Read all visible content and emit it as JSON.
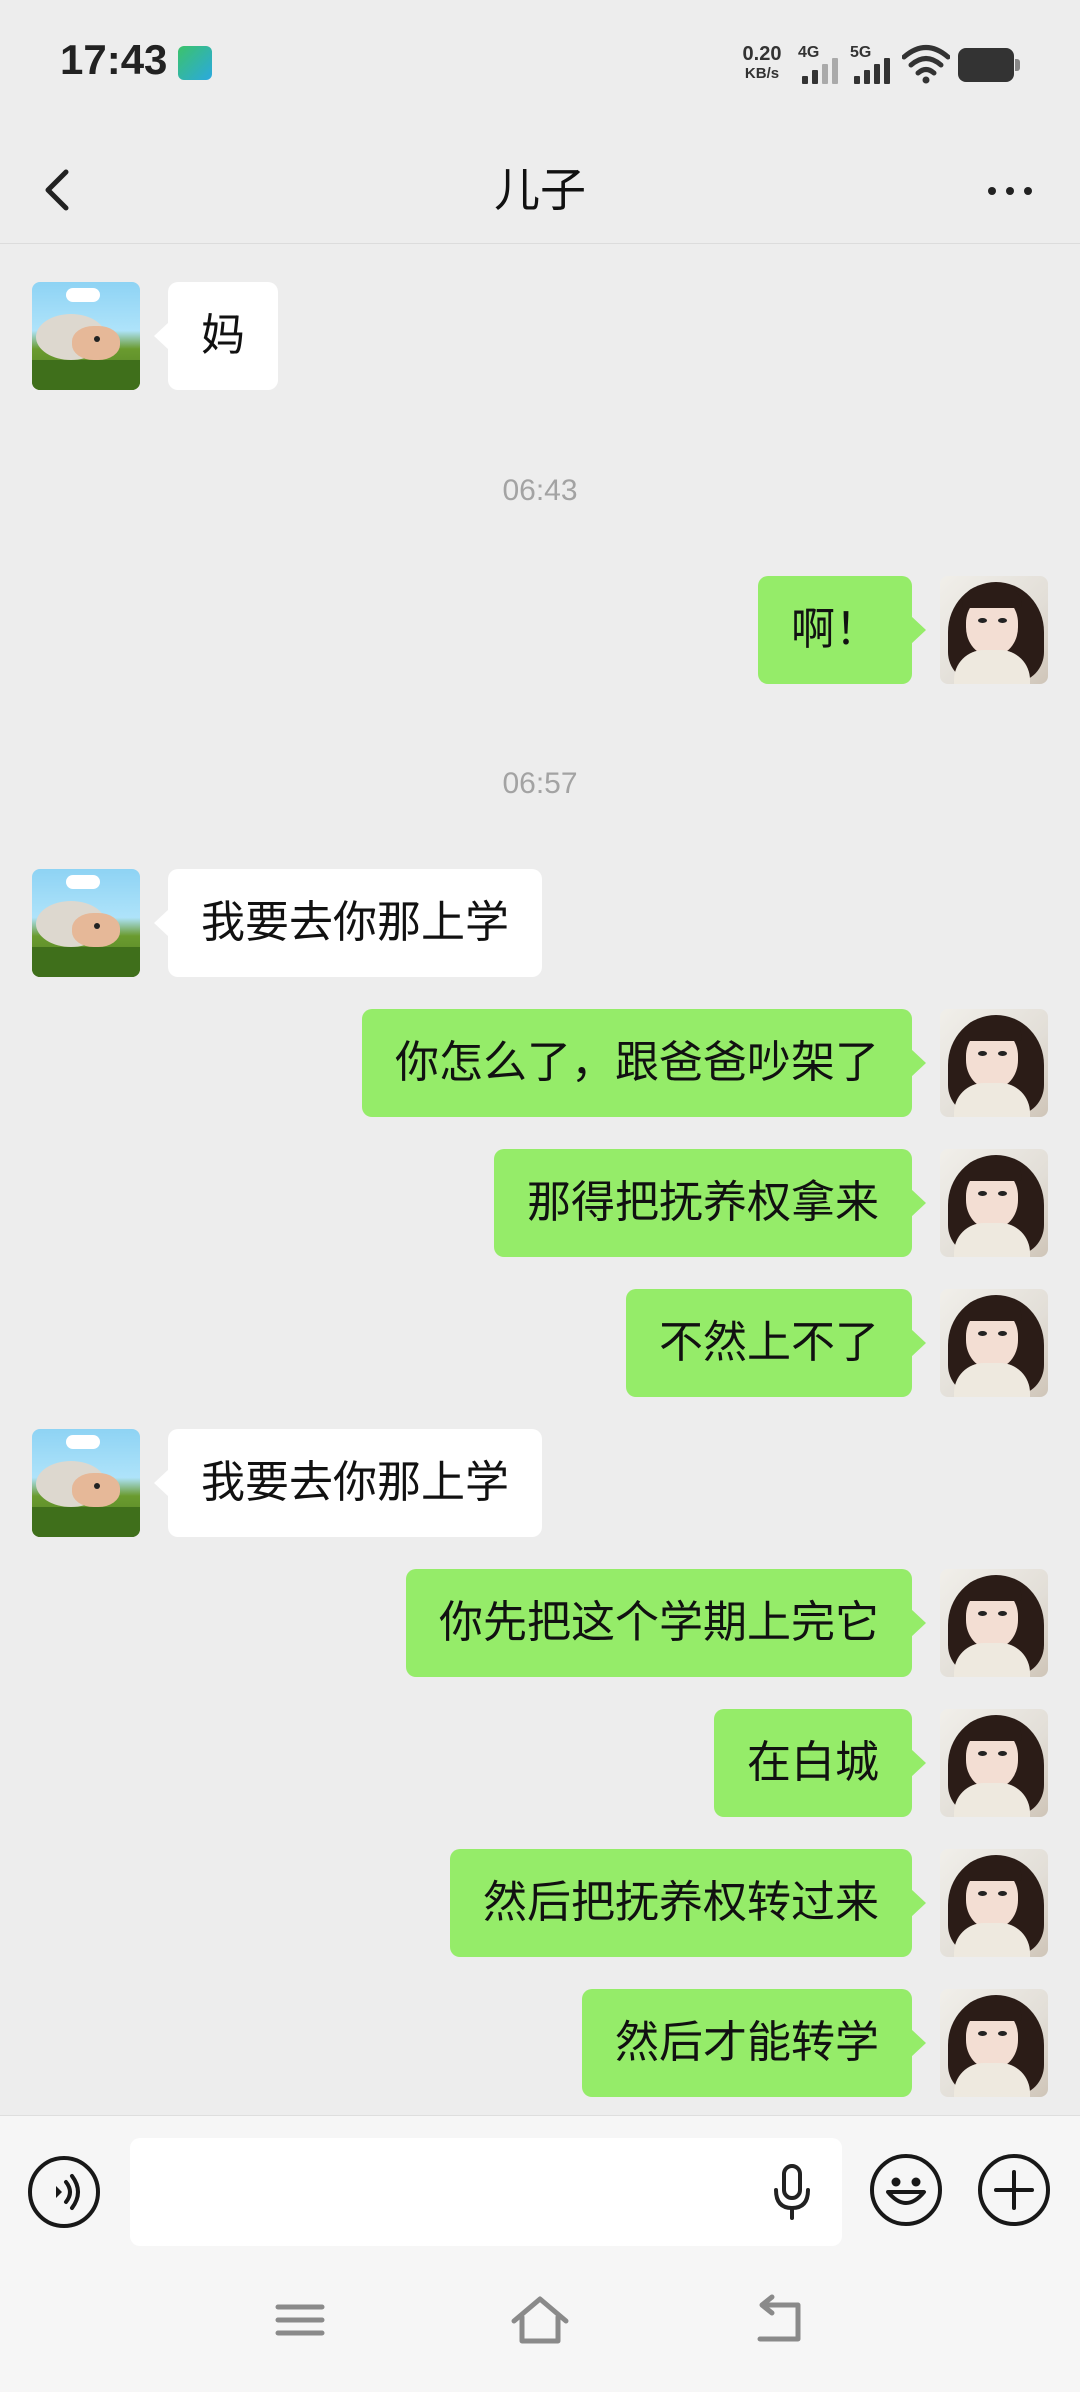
{
  "status_bar": {
    "time": "17:43",
    "net_speed_value": "0.20",
    "net_speed_unit": "KB/s",
    "signal_1_label": "4G",
    "signal_2_label": "5G"
  },
  "header": {
    "title": "儿子"
  },
  "messages": [
    {
      "side": "in",
      "text": "妈"
    },
    {
      "timestamp": "06:43"
    },
    {
      "side": "out",
      "text": "啊！"
    },
    {
      "timestamp": "06:57"
    },
    {
      "side": "in",
      "text": "我要去你那上学"
    },
    {
      "side": "out",
      "text": "你怎么了，跟爸爸吵架了"
    },
    {
      "side": "out",
      "text": "那得把抚养权拿来"
    },
    {
      "side": "out",
      "text": "不然上不了"
    },
    {
      "side": "in",
      "text": "我要去你那上学"
    },
    {
      "side": "out",
      "text": "你先把这个学期上完它"
    },
    {
      "side": "out",
      "text": "在白城"
    },
    {
      "side": "out",
      "text": "然后把抚养权转过来"
    },
    {
      "side": "out",
      "text": "然后才能转学"
    }
  ],
  "input_bar": {
    "value": "",
    "placeholder": ""
  },
  "colors": {
    "background": "#ededed",
    "outgoing_bubble": "#95ec69",
    "incoming_bubble": "#ffffff",
    "timestamp_text": "#a3a3a3"
  },
  "icons": {
    "back": "chevron-left-icon",
    "more": "more-dots-icon",
    "voice": "voice-mode-icon",
    "mic": "mic-icon",
    "emoji": "emoji-icon",
    "plus": "plus-icon",
    "nav_menu": "menu-icon",
    "nav_home": "home-icon",
    "nav_back": "back-arrow-icon"
  }
}
